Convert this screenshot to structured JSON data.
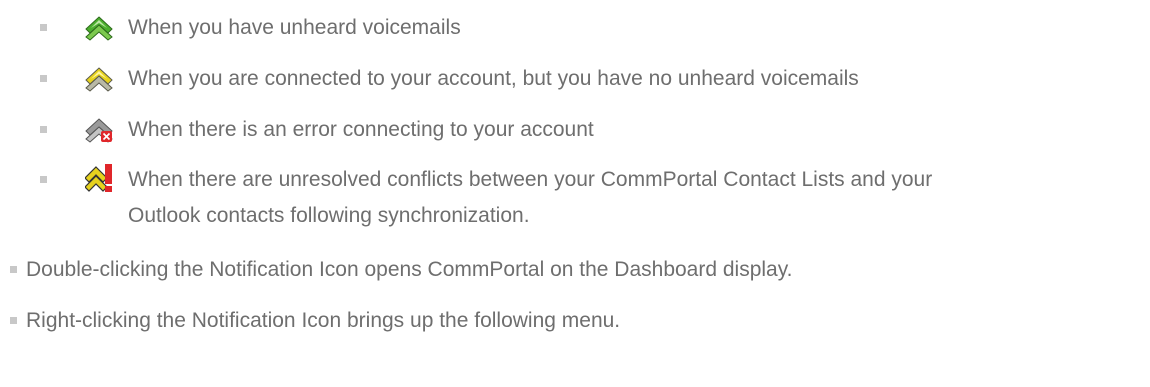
{
  "status_list": {
    "items": [
      {
        "icon": "green-chevron-icon",
        "text": "When you have unheard voicemails"
      },
      {
        "icon": "yellow-chevron-icon",
        "text": "When you are connected to your account, but you have no unheard voicemails"
      },
      {
        "icon": "grey-chevron-error-icon",
        "text": "When there is an error connecting to your account"
      },
      {
        "icon": "yellow-chevron-conflict-icon",
        "text_line1": "When there are unresolved conflicts between your CommPortal Contact Lists and your",
        "text_line2": "Outlook contacts following synchronization."
      }
    ]
  },
  "notes": {
    "items": [
      {
        "text": "Double-clicking the Notification Icon opens CommPortal on the Dashboard display."
      },
      {
        "text": "Right-clicking the Notification Icon brings up the following menu."
      }
    ]
  },
  "colors": {
    "text": "#6e6e6e",
    "bullet": "#c8c8c8",
    "green": "#4caf2e",
    "yellow": "#e6d21e",
    "grey": "#9a9a9a",
    "red": "#e0262a"
  }
}
